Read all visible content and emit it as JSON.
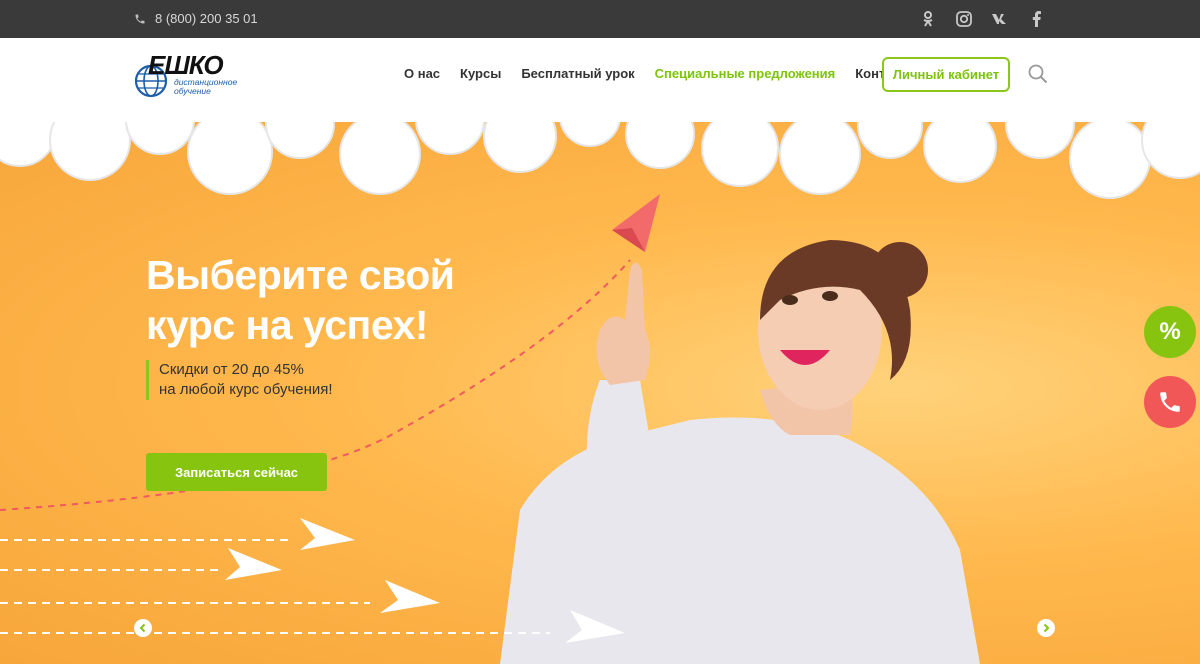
{
  "topbar": {
    "phone": "8 (800) 200 35 01",
    "socials": [
      "odnoklassniki-icon",
      "instagram-icon",
      "vk-icon",
      "facebook-icon"
    ]
  },
  "header": {
    "logo": {
      "brand": "ЕШКО",
      "subtitle_line1": "дистанционное",
      "subtitle_line2": "обучение"
    },
    "nav": [
      "О нас",
      "Курсы",
      "Бесплатный урок",
      "Специальные предложения",
      "Контакты"
    ],
    "active_nav": "Специальные предложения",
    "cabinet_label": "Личный кабинет"
  },
  "hero": {
    "title_line1": "Выберите свой",
    "title_line2": "курс на успех!",
    "promo_line1": "Скидки от 20 до 45%",
    "promo_line2": "на любой курс обучения!",
    "cta_label": "Записаться сейчас"
  },
  "fab": {
    "percent": "%"
  },
  "colors": {
    "accent": "#86c410",
    "topbar": "#3a3a3a",
    "hero_bg": "#ffb84d",
    "call": "#f25757",
    "plane_pink": "#f26a6a"
  }
}
